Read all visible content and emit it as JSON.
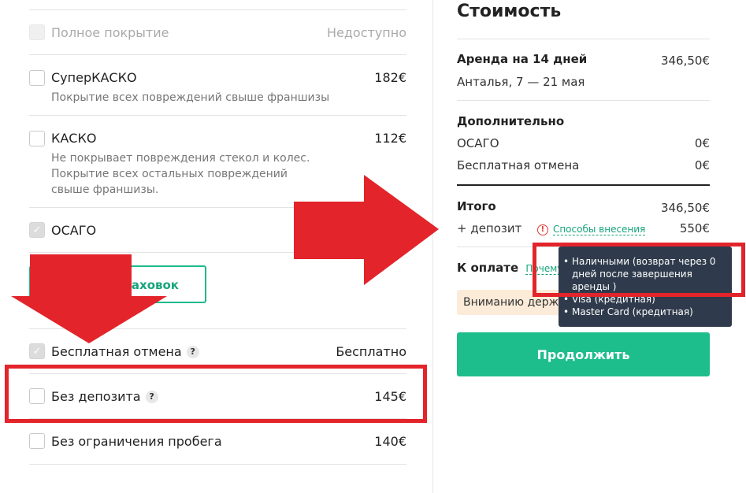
{
  "options": [
    {
      "label": "Полное покрытие",
      "price": "Недоступно",
      "state": "disabled"
    },
    {
      "label": "СуперКАСКО",
      "price": "182€",
      "desc": "Покрытие всех повреждений свыше франшизы",
      "state": "unchecked"
    },
    {
      "label": "КАСКО",
      "price": "112€",
      "desc": "Не покрывает повреждения стекол и колес. Покрытие всех остальных повреждений свыше франшизы.",
      "state": "unchecked"
    },
    {
      "label": "ОСАГО",
      "price": "",
      "state": "checked"
    }
  ],
  "insurance_button": {
    "label": "раховок"
  },
  "extras": [
    {
      "label": "Бесплатная отмена",
      "price": "Бесплатно",
      "help": "?",
      "state": "checked"
    },
    {
      "label": "Без депозита",
      "price": "145€",
      "help": "?",
      "state": "unchecked"
    },
    {
      "label": "Без ограничения пробега",
      "price": "140€",
      "state": "unchecked"
    }
  ],
  "summary": {
    "title": "Стоимость",
    "rental_label": "Аренда на 14 дней",
    "rental_price": "346,50€",
    "rental_sub": "Анталья, 7 — 21 мая",
    "extras_heading": "Дополнительно",
    "extras": [
      {
        "label": "ОСАГО",
        "price": "0€"
      },
      {
        "label": "Бесплатная отмена",
        "price": "0€"
      }
    ],
    "total_label": "Итого",
    "total_price": "346,50€",
    "deposit_label": "+ депозит",
    "deposit_warn": "!",
    "deposit_link": "Способы внесения",
    "deposit_price": "550€",
    "pay_label": "К оплате",
    "pay_link": "Почему?",
    "notice": "Вниманию держа",
    "continue": "Продолжить"
  },
  "tooltip": {
    "items": [
      "Наличными (возврат через 0 дней после завершения аренды )",
      "Visa (кредитная)",
      "Master Card (кредитная)"
    ]
  },
  "icons": {
    "check": "✓"
  },
  "colors": {
    "accent": "#1ebd8c",
    "annotation_red": "#e3242b",
    "tooltip_bg": "#2f3b4c"
  }
}
